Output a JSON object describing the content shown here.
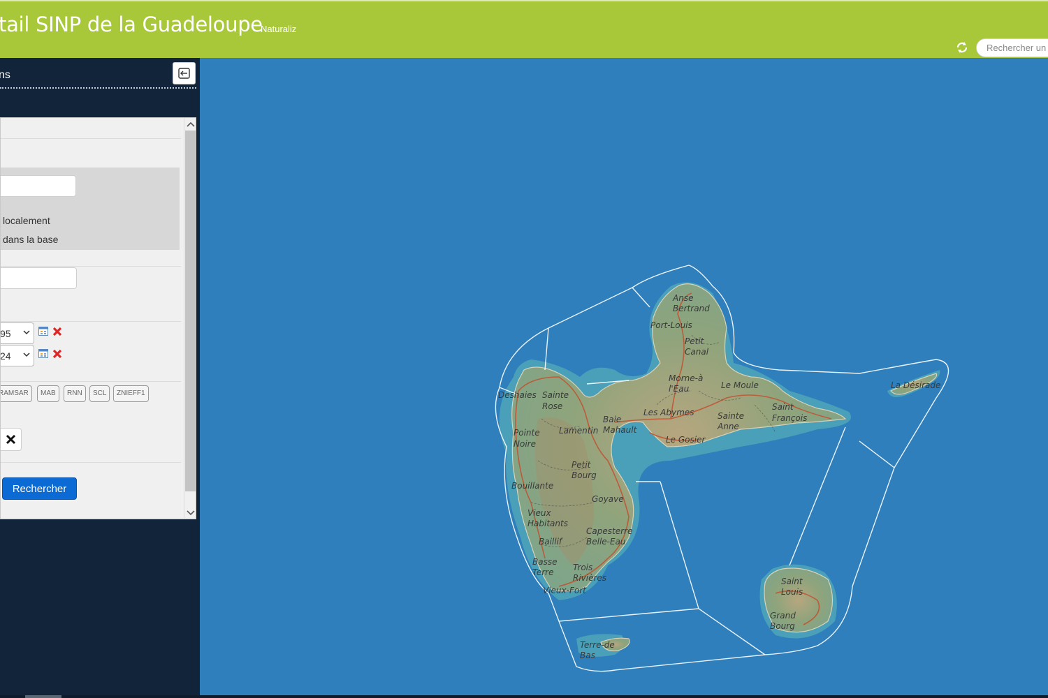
{
  "header": {
    "title": "tail SINP de la Guadeloupe",
    "subtitle": "Naturaliz",
    "search_placeholder": "Rechercher un"
  },
  "panel": {
    "title": "ns",
    "form": {
      "location_option_local": "localement",
      "location_option_base": "dans la base",
      "date_from_value": "95",
      "date_to_value": "24",
      "protected_area_tags": [
        "RAMSAR",
        "MAB",
        "RNN",
        "SCL",
        "ZNIEFF1"
      ],
      "search_button_label": "Rechercher"
    }
  },
  "map": {
    "town_labels": [
      "Anse",
      "Bertrand",
      "Port-Louis",
      "Petit",
      "Canal",
      "Morne-à",
      "l'Eau",
      "Le Moule",
      "La Désirade",
      "Saint",
      "François",
      "Sainte",
      "Anne",
      "Les Abymes",
      "Le Gosier",
      "Deshaies",
      "Sainte",
      "Rose",
      "Baie",
      "Mahault",
      "Lamentin",
      "Pointe",
      "Noire",
      "Petit",
      "Bourg",
      "Bouillante",
      "Goyave",
      "Vieux",
      "Habitants",
      "Capesterre",
      "Belle-Eau",
      "Baillif",
      "Basse",
      "Terre",
      "Trois",
      "Rivières",
      "Vieux-Fort",
      "Saint",
      "Louis",
      "Grand",
      "Bourg",
      "Terre-de",
      "Bas"
    ]
  },
  "colors": {
    "header_green": "#a8c83a",
    "panel_navy": "#12243a",
    "sea_blue": "#2e7fbb",
    "button_blue": "#0c6ad4"
  }
}
